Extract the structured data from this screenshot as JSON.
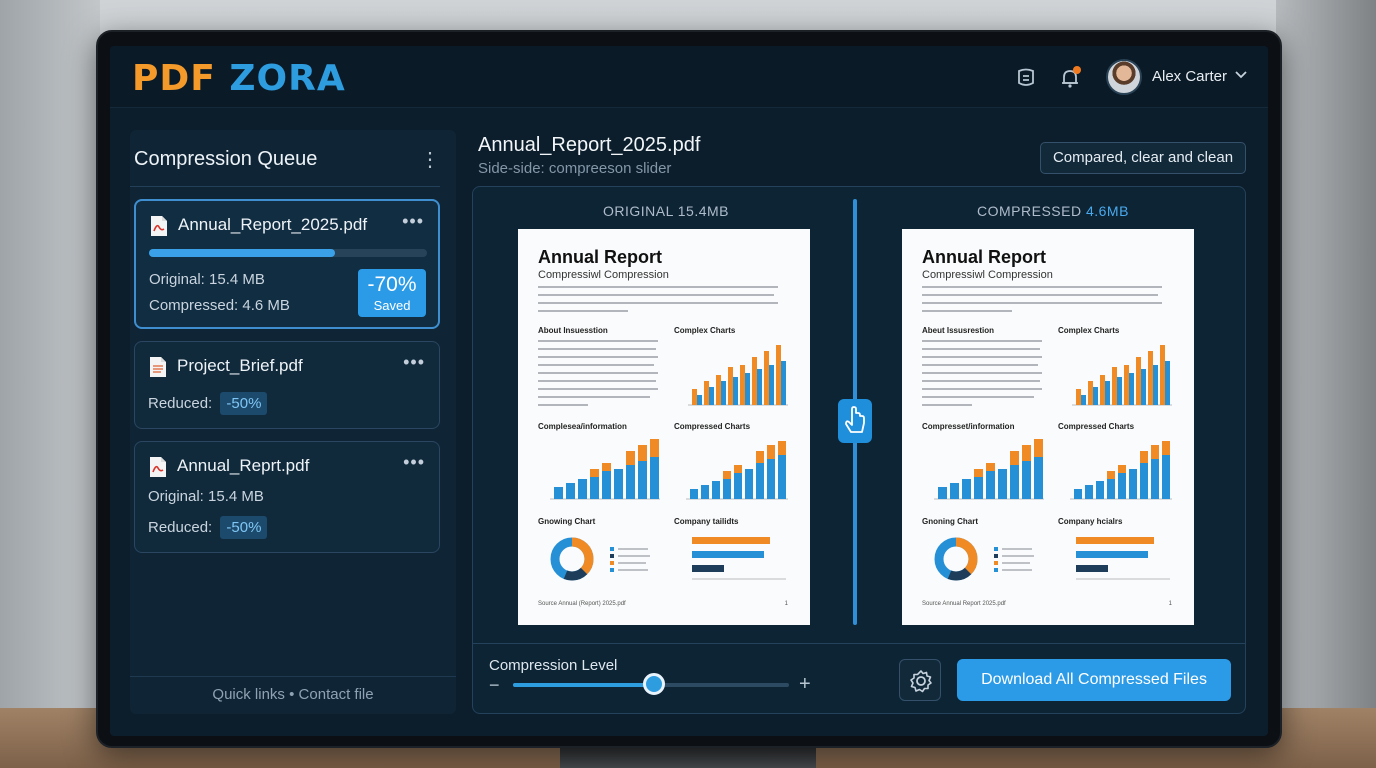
{
  "app": {
    "logo_left": "PDF",
    "logo_right": "ZORA",
    "user_name": "Alex Carter"
  },
  "colors": {
    "accent": "#2e9de0",
    "brand_orange": "#f39a2a",
    "notification_dot": "#f07a20"
  },
  "icons": {
    "header": [
      "clipboard-icon",
      "bell-icon",
      "chevron-down-icon"
    ],
    "file": "pdf-file-icon",
    "settings": "gear-icon",
    "slider_handle": "hand-pointer-icon"
  },
  "sidebar": {
    "title": "Compression Queue",
    "items": [
      {
        "file": "Annual_Report_2025.pdf",
        "progress": 0.67,
        "line1": "Original: 15.4 MB",
        "line2": "Compressed: 4.6 MB",
        "saved_pct": "-70%",
        "saved_label": "Saved"
      },
      {
        "file": "Project_Brief.pdf",
        "reduced_label": "Reduced:",
        "reduced_value": "-50%"
      },
      {
        "file": "Annual_Reprt.pdf",
        "line1": "Original: 15.4 MB",
        "reduced_label": "Reduced:",
        "reduced_value": "-50%"
      }
    ],
    "footer_link1": "Quick links",
    "footer_sep": "•",
    "footer_link2": "Contact file"
  },
  "main": {
    "title": "Annual_Report_2025.pdf",
    "subtitle": "Side-side: compreeson slider",
    "compare_button": "Compared, clear and clean",
    "original_label": "ORIGINAL 15.4MB",
    "compressed_label_prefix": "COMPRESSED",
    "compressed_label_value": "4.6MB",
    "compression_level_label": "Compression Level",
    "compression_level": 0.51,
    "download_button": "Download All Compressed Files"
  },
  "preview_left": {
    "title": "Annual Report",
    "subtitle": "Compressiwl Compression",
    "sec_a": "About Insuesstion",
    "sec_b": "Complex Charts",
    "sec_c": "Complesea/information",
    "sec_d": "Compressed Charts",
    "sec_e": "Gnowing Chart",
    "sec_f": "Company tailidts",
    "footer": "Source Annual (Report) 2025.pdf",
    "page_no": "1"
  },
  "preview_right": {
    "title": "Annual Report",
    "subtitle": "Compressiwl Compression",
    "sec_a": "Abeut Issusrestion",
    "sec_b": "Complex Charts",
    "sec_c": "Compresset/information",
    "sec_d": "Compressed Charts",
    "sec_e": "Gnoning Chart",
    "sec_f": "Company hcialrs",
    "footer": "Source Annual Report 2025.pdf",
    "page_no": "1"
  }
}
